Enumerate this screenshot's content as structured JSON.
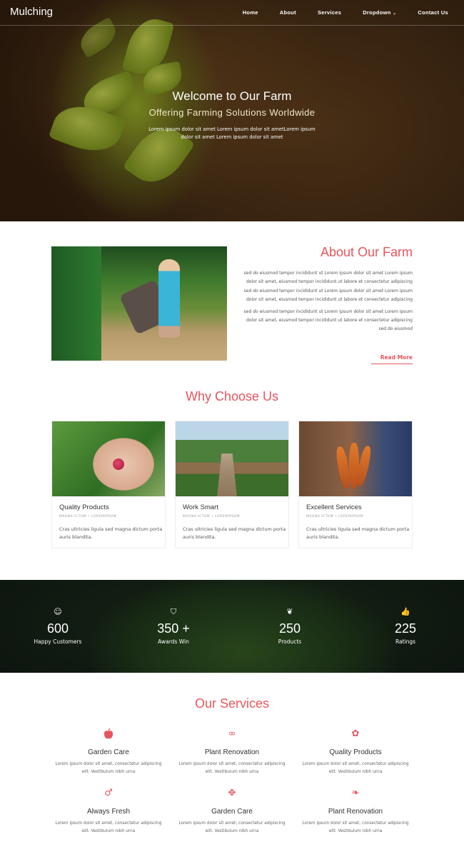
{
  "brand": "Mulching",
  "nav": [
    "Home",
    "About",
    "Services",
    "Dropdown",
    "Contact Us"
  ],
  "hero": {
    "title": "Welcome to Our Farm",
    "subtitle": "Offering Farming Solutions Worldwide",
    "text": "Lorem ipsum dolor sit amet Lorem ipsum dolor sit ametLorem ipsum dolor sit amet Lorem ipsum dolor sit amet"
  },
  "about": {
    "title": "About Our Farm",
    "paragraph1": "sed do eiusmod tempor incididunt ut Lorem ipsum dolor sit amet Lorem ipsum dolor sit amet, eiusmod tempor incididunt ut labore et consectetur adipiscing sed do eiusmod tempor incididunt ut Lorem ipsum dolor sit amet Lorem ipsum dolor sit amet, eiusmod tempor incididunt ut labore et consectetur adipiscing",
    "paragraph2": "sed do eiusmod tempor incididunt ut Lorem ipsum dolor sit amet Lorem ipsum dolor sit amet, eiusmod tempor incididunt ut labore et consectetur adipiscing sed do eiusmod",
    "read_more": "Read More"
  },
  "why": {
    "title": "Why Choose Us",
    "cards": [
      {
        "title": "Quality Products",
        "meta": "MAGNA ICTUM  •  LOREMIPSUM",
        "text": "Cras ultricies ligula sed magna dictum porta auris blandita."
      },
      {
        "title": "Work Smart",
        "meta": "MAGNA ICTUM  •  LOREMIPSUM",
        "text": "Cras ultricies ligula sed magna dictum porta auris blandita."
      },
      {
        "title": "Excellent Services",
        "meta": "MAGNA ICTUM  •  LOREMIPSUM",
        "text": "Cras ultricies ligula sed magna dictum porta auris blandita."
      }
    ]
  },
  "stats": [
    {
      "icon": "smile-icon",
      "glyph": "☺",
      "number": "600",
      "label": "Happy Customers"
    },
    {
      "icon": "shield-icon",
      "glyph": "⛉",
      "number": "350 +",
      "label": "Awards Win"
    },
    {
      "icon": "leaf-icon",
      "glyph": "❦",
      "number": "250",
      "label": "Products"
    },
    {
      "icon": "thumbs-up-icon",
      "glyph": "👍",
      "number": "225",
      "label": "Ratings"
    }
  ],
  "services": {
    "title": "Our Services",
    "items": [
      {
        "icon": "apple-icon",
        "glyph": "",
        "title": "Garden Care",
        "text": "Lorem ipsum dolor sit amet, consectetur adipiscing elit. Vestibulum nibh urna"
      },
      {
        "icon": "infinity-icon",
        "glyph": "∞",
        "title": "Plant Renovation",
        "text": "Lorem ipsum dolor sit amet, consectetur adipiscing elit. Vestibulum nibh urna"
      },
      {
        "icon": "flower-icon",
        "glyph": "✿",
        "title": "Quality Products",
        "text": "Lorem ipsum dolor sit amet, consectetur adipiscing elit. Vestibulum nibh urna"
      },
      {
        "icon": "mars-icon",
        "glyph": "♂",
        "title": "Always Fresh",
        "text": "Lorem ipsum dolor sit amet, consectetur adipiscing elit. Vestibulum nibh urna"
      },
      {
        "icon": "tree-icon",
        "glyph": "✥",
        "title": "Garden Care",
        "text": "Lorem ipsum dolor sit amet, consectetur adipiscing elit. Vestibulum nibh urna"
      },
      {
        "icon": "leaf-icon",
        "glyph": "❧",
        "title": "Plant Renovation",
        "text": "Lorem ipsum dolor sit amet, consectetur adipiscing elit. Vestibulum nibh urna"
      }
    ]
  },
  "colors": {
    "accent": "#e8555d",
    "text": "#444444"
  }
}
